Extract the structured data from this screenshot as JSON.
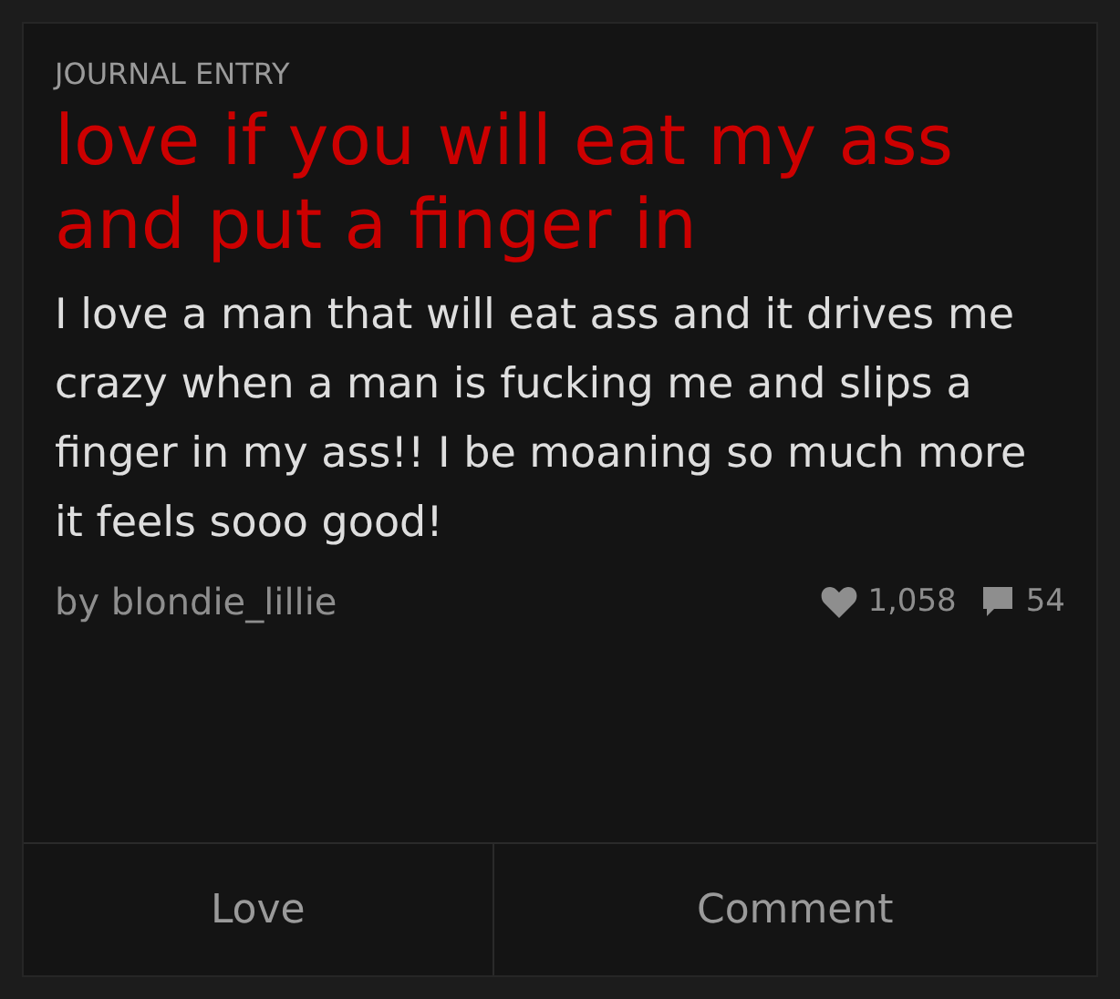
{
  "post": {
    "category": "JOURNAL ENTRY",
    "title": "love if you will eat my ass and put a finger in",
    "body": "I love a man that will eat ass and it drives me crazy when a man is fucking me and slips a finger in my ass!! I be moaning so much more it feels sooo good!",
    "author": "by blondie_lillie",
    "likes": "1,058",
    "comments": "54"
  },
  "actions": [
    "Love",
    "Comment"
  ]
}
